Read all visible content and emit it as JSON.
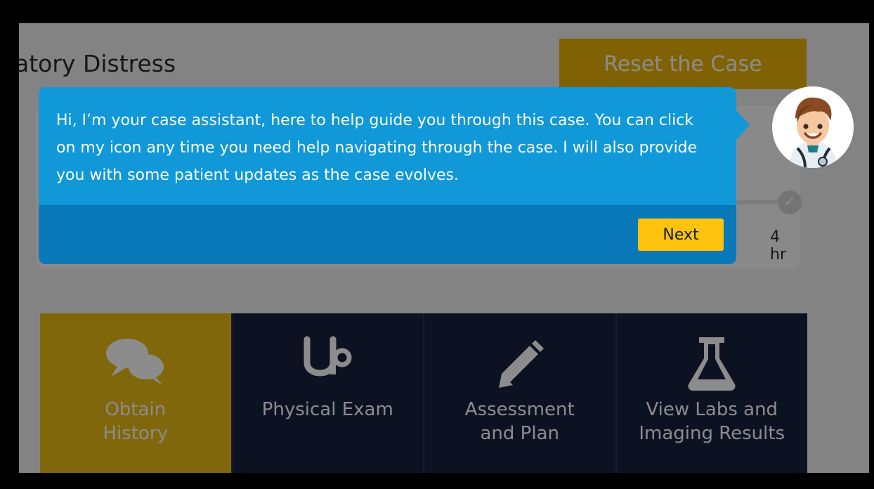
{
  "header": {
    "title": "atory Distress",
    "reset_label": "Reset the Case"
  },
  "timeline": {
    "time_label": "4 hr"
  },
  "actions": [
    {
      "label": "Obtain\nHistory",
      "icon": "speech-bubbles-icon",
      "active": true
    },
    {
      "label": "Physical Exam",
      "icon": "stethoscope-icon",
      "active": false
    },
    {
      "label": "Assessment\nand Plan",
      "icon": "pencil-icon",
      "active": false
    },
    {
      "label": "View Labs and\nImaging Results",
      "icon": "flask-icon",
      "active": false
    }
  ],
  "assistant": {
    "message": "Hi, I’m your case assistant, here to help guide you through this case. You can click on my icon any time you need help navigating through the case. I will also provide you with some patient updates as the case evolves.",
    "next_label": "Next",
    "avatar_icon": "doctor-avatar-icon"
  },
  "colors": {
    "accent_yellow": "#eab308",
    "bubble_blue": "#1098d8",
    "bubble_dark_blue": "#0a79b9",
    "nav_navy": "#16213f"
  }
}
